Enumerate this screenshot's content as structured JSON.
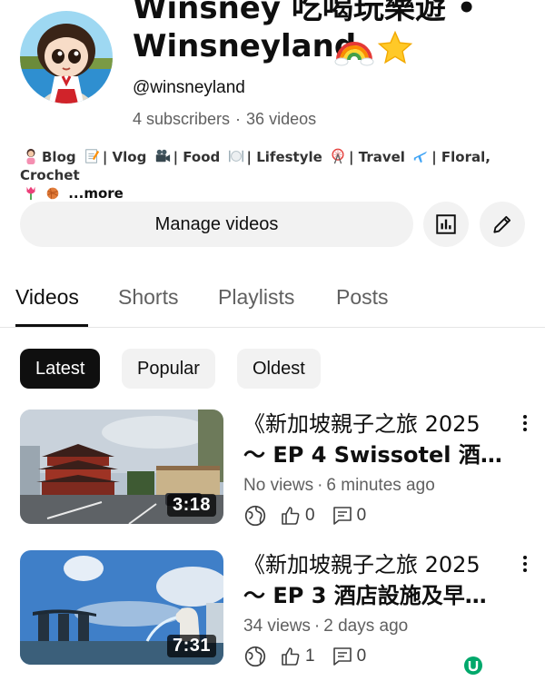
{
  "channel": {
    "title_line1": "Winsney 吃喝玩樂遊 •",
    "title_line2": "Winsneyland",
    "title_emojis": [
      "rainbow-icon",
      "star-icon"
    ],
    "handle": "@winsneyland",
    "subscribers": "4 subscribers",
    "videos_count": "36 videos",
    "description": {
      "parts": [
        {
          "emoji": "woman-icon"
        },
        {
          "text": "Blog"
        },
        {
          "emoji": "memo-icon"
        },
        {
          "text": "| Vlog"
        },
        {
          "emoji": "movie-camera-icon"
        },
        {
          "text": "| Food"
        },
        {
          "emoji": "plate-icon"
        },
        {
          "text": "| Lifestyle"
        },
        {
          "emoji": "ferris-wheel-icon"
        },
        {
          "text": "| Travel"
        },
        {
          "emoji": "airplane-icon"
        },
        {
          "text": "| Floral, Crochet"
        }
      ],
      "seg1": "Blog",
      "seg2": "| Vlog",
      "seg3": "| Food",
      "seg4": "| Lifestyle",
      "seg5": "| Travel",
      "seg6": "| Floral, Crochet",
      "more": "...more"
    }
  },
  "actions": {
    "manage_label": "Manage videos",
    "analytics_icon": "bar-chart-icon",
    "edit_icon": "pencil-icon"
  },
  "tabs": [
    {
      "label": "Videos",
      "active": true
    },
    {
      "label": "Shorts",
      "active": false
    },
    {
      "label": "Playlists",
      "active": false
    },
    {
      "label": "Posts",
      "active": false
    }
  ],
  "filters": [
    {
      "label": "Latest",
      "active": true
    },
    {
      "label": "Popular",
      "active": false
    },
    {
      "label": "Oldest",
      "active": false
    }
  ],
  "videos": [
    {
      "title_line1": "《新加坡親子之旅 2025",
      "title_line2": "～ EP 4  Swissotel 酒…",
      "views": "No views",
      "age": "6 minutes ago",
      "duration": "3:18",
      "likes": "0",
      "comments": "0"
    },
    {
      "title_line1": "《新加坡親子之旅 2025",
      "title_line2": "～ EP 3 酒店設施及早…",
      "views": "34 views",
      "age": "2 days ago",
      "duration": "7:31",
      "likes": "1",
      "comments": "0"
    }
  ],
  "colors": {
    "accent_dark": "#0f0f0f",
    "chip_bg": "#f2f2f2",
    "secondary_text": "#606060",
    "watermark": "#00a86b"
  }
}
